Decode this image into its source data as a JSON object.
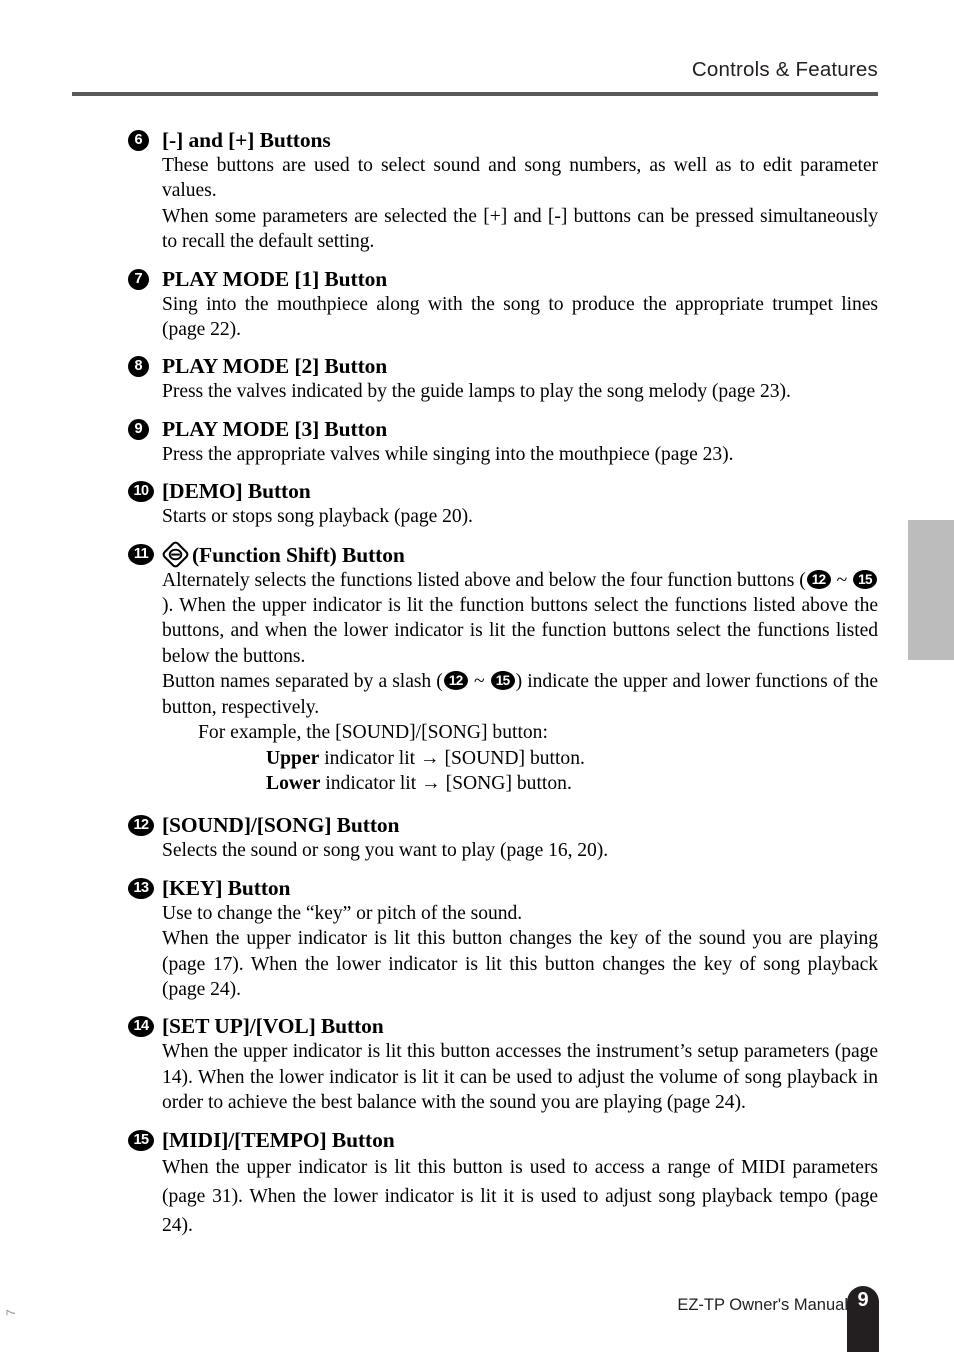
{
  "header": {
    "title": "Controls & Features"
  },
  "entries": [
    {
      "num": "6",
      "num_style": "one",
      "title": "[-] and [+] Buttons",
      "paras": [
        "These buttons are used to select sound and song numbers, as well as to edit parameter values.",
        "When some parameters are selected the [+] and [-] buttons can be pressed simultaneously to recall the default setting."
      ]
    },
    {
      "num": "7",
      "num_style": "one",
      "title": "PLAY MODE [1] Button",
      "paras": [
        "Sing into the mouthpiece along with the song to produce the appropriate trumpet lines (page 22)."
      ]
    },
    {
      "num": "8",
      "num_style": "one",
      "title": "PLAY MODE [2] Button",
      "paras": [
        "Press the valves indicated by the guide lamps to play the song melody (page 23)."
      ]
    },
    {
      "num": "9",
      "num_style": "one",
      "title": "PLAY MODE [3] Button",
      "paras": [
        "Press the appropriate valves while singing into the mouthpiece (page 23)."
      ]
    },
    {
      "num": "10",
      "num_style": "two",
      "title": "[DEMO] Button",
      "paras": [
        "Starts or stops song playback (page 20)."
      ]
    }
  ],
  "function_shift": {
    "num": "11",
    "num_style": "two",
    "icon": "function-shift-diamond-icon",
    "title": "(Function Shift) Button",
    "para1_a": "Alternately selects the functions listed above and below the four function buttons (",
    "para1_ref1": "12",
    "para1_tilde": " ~ ",
    "para1_ref2": "15",
    "para1_b": "). When the upper indicator is lit the function buttons select the functions listed above the buttons, and when the lower indicator is lit the function buttons select the functions listed below the buttons.",
    "para2_a": "Button names separated by a slash (",
    "para2_ref1": "12",
    "para2_tilde": " ~ ",
    "para2_ref2": "15",
    "para2_b": ") indicate the upper and lower functions of the button, respectively.",
    "example_intro": "For example, the [SOUND]/[SONG] button:",
    "example_upper_bold": "Upper",
    "example_upper_rest": " indicator lit → [SOUND] button.",
    "example_lower_bold": "Lower",
    "example_lower_rest": " indicator lit → [SONG] button."
  },
  "entries2": [
    {
      "num": "12",
      "num_style": "two",
      "title": "[SOUND]/[SONG] Button",
      "paras": [
        "Selects the sound or song you want to play (page 16, 20)."
      ]
    },
    {
      "num": "13",
      "num_style": "two",
      "title": "[KEY] Button",
      "paras": [
        "Use to change the “key” or pitch of the sound.",
        "When the upper indicator is lit this button changes the key of the sound you are playing (page 17). When the lower indicator is lit this button changes the key of song playback (page 24)."
      ]
    },
    {
      "num": "14",
      "num_style": "two",
      "title": "[SET UP]/[VOL] Button",
      "paras": [
        "When the upper indicator is lit this button accesses the instrument’s setup parameters (page 14). When the lower indicator is lit it can be used to adjust the volume of song playback in order to achieve the best balance with the sound you are playing (page 24)."
      ]
    },
    {
      "num": "15",
      "num_style": "two",
      "title": "[MIDI]/[TEMPO] Button",
      "paras": [
        "When the upper indicator is lit this button is used to access a range of MIDI parameters (page 31). When the lower indicator is lit it is used to adjust song playback tempo (page 24)."
      ]
    }
  ],
  "footer": {
    "manual_text": "EZ-TP  Owner's Manual",
    "page_number": "9"
  },
  "edge_mark": "7",
  "colors": {
    "rule": "#595959",
    "side_tab": "#bcbcbc",
    "page_tab": "#231f20",
    "text": "#000000"
  }
}
